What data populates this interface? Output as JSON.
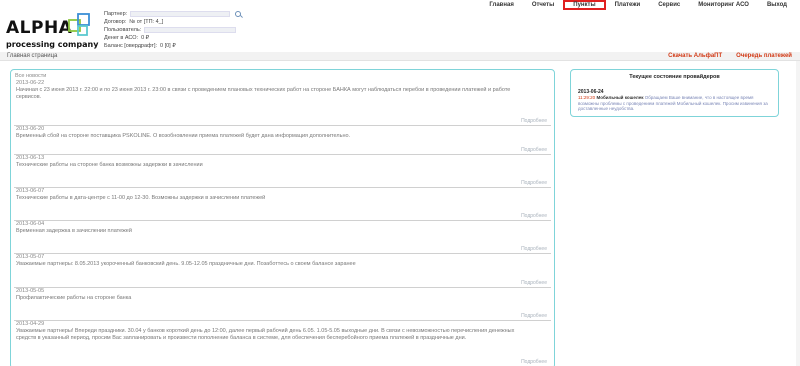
{
  "logo": {
    "title": "ALPHA",
    "subtitle": "processing company",
    "colors": {
      "green": "#8cc63f",
      "blue": "#3b8fd6",
      "cyan": "#5bc8d0"
    }
  },
  "info": {
    "partner_label": "Партнер:",
    "contract_label": "Договор:",
    "contract_value": "№ от  [ТП: 4_]",
    "user_label": "Пользователь:",
    "money_label": "Денег в АСО:",
    "money_value": "0 ₽",
    "balance_label": "Баланс [овердрафт]:",
    "balance_value": "0 [0] ₽"
  },
  "nav": {
    "items": [
      {
        "label": "Главная"
      },
      {
        "label": "Отчеты"
      },
      {
        "label": "Пункты"
      },
      {
        "label": "Платежи"
      },
      {
        "label": "Сервис"
      },
      {
        "label": "Мониторинг АСО"
      },
      {
        "label": "Выход"
      }
    ],
    "highlight_color": "#e02020"
  },
  "breadcrumb": "Главная страница",
  "sublinks": {
    "download": "Скачать АльфаПТ",
    "queue": "Очередь платежей"
  },
  "news": {
    "all_link": "Все новости",
    "more_label": "Подробнее",
    "items": [
      {
        "date": "2013-06-22",
        "text": "Начиная с 23 июня 2013 г. 22:00 и по 23 июня 2013 г. 23:00 в связи с проведением плановых технических работ на стороне БАНКА могут наблюдаться перебои в проведении платежей и работе сервисов."
      },
      {
        "date": "2013-06-20",
        "text": "Временный сбой на стороне поставщика PSKOLINE. О возобновлении приема платежей будет дана информация дополнительно."
      },
      {
        "date": "2013-06-13",
        "text": "Технические работы на стороне банка возможны задержки в зачислении"
      },
      {
        "date": "2013-06-07",
        "text": "Технические работы в дата-центре с 11-00 до 12-30. Возможны задержки в зачислении платежей"
      },
      {
        "date": "2013-06-04",
        "text": "Временная задержка в зачислении платежей"
      },
      {
        "date": "2013-05-07",
        "text": "Уважаемые партнеры: 8.05.2013 укороченный банковский день. 9.05-12.05 праздничные дни. Позаботтесь о своем балансе заранее"
      },
      {
        "date": "2013-05-05",
        "text": "Профилактические работы на стороне банка"
      },
      {
        "date": "2013-04-29",
        "text": "Уважаемые партнеры! Впереди праздники. 30.04 у банков короткий день до 12:00, далее первый рабочий день 6.05. 1.05-5.05 выходные дни. В связи с невозможностью перечисления денежных средств в указанный период, просим Вас запланировать и произвести пополнение баланса в системе, для обеспечения бесперебойного приема платежей в праздничные дни."
      }
    ]
  },
  "providers": {
    "title": "Текущее состояние провайдеров",
    "date": "2013-06-24",
    "time": "11:29:20",
    "name": "Мобильный кошелек",
    "message": "Обращаем Ваше внимание, что в настоящее время возможны проблемы с проведением платежей Мобильный кошелек. Просим извинения за доставленные неудобства."
  }
}
